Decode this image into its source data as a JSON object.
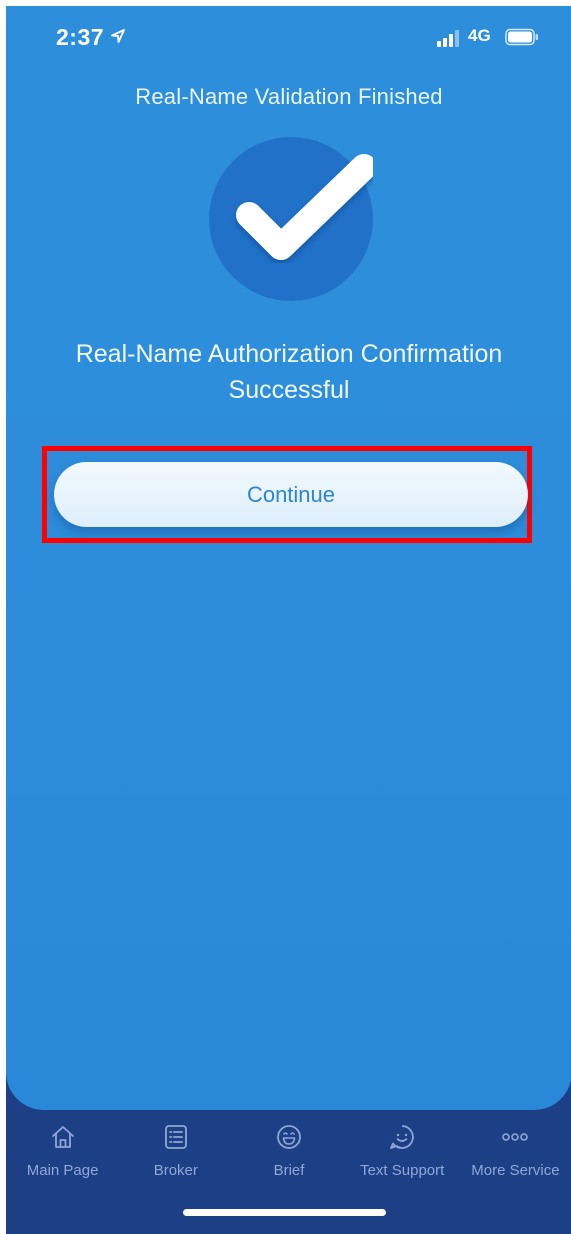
{
  "status_bar": {
    "time": "2:37",
    "network": "4G",
    "icons": [
      "location-arrow-icon",
      "cellular-signal-icon",
      "battery-icon"
    ]
  },
  "page": {
    "title": "Real-Name Validation Finished",
    "status_icon": "checkmark-icon",
    "message_line1": "Real-Name Authorization Confirmation",
    "message_line2": "Successful",
    "continue_label": "Continue"
  },
  "colors": {
    "background": "#2d8ddb",
    "circle": "#2171c8",
    "button_text": "#2b86d1",
    "tab_bar": "#1c3f86",
    "tab_text": "#8fa7d6",
    "highlight": "#ff0000"
  },
  "tabs": [
    {
      "label": "Main Page",
      "icon": "home-icon"
    },
    {
      "label": "Broker",
      "icon": "list-icon"
    },
    {
      "label": "Brief",
      "icon": "smile-icon"
    },
    {
      "label": "Text Support",
      "icon": "chat-smile-icon"
    },
    {
      "label": "More Service",
      "icon": "more-dots-icon"
    }
  ]
}
